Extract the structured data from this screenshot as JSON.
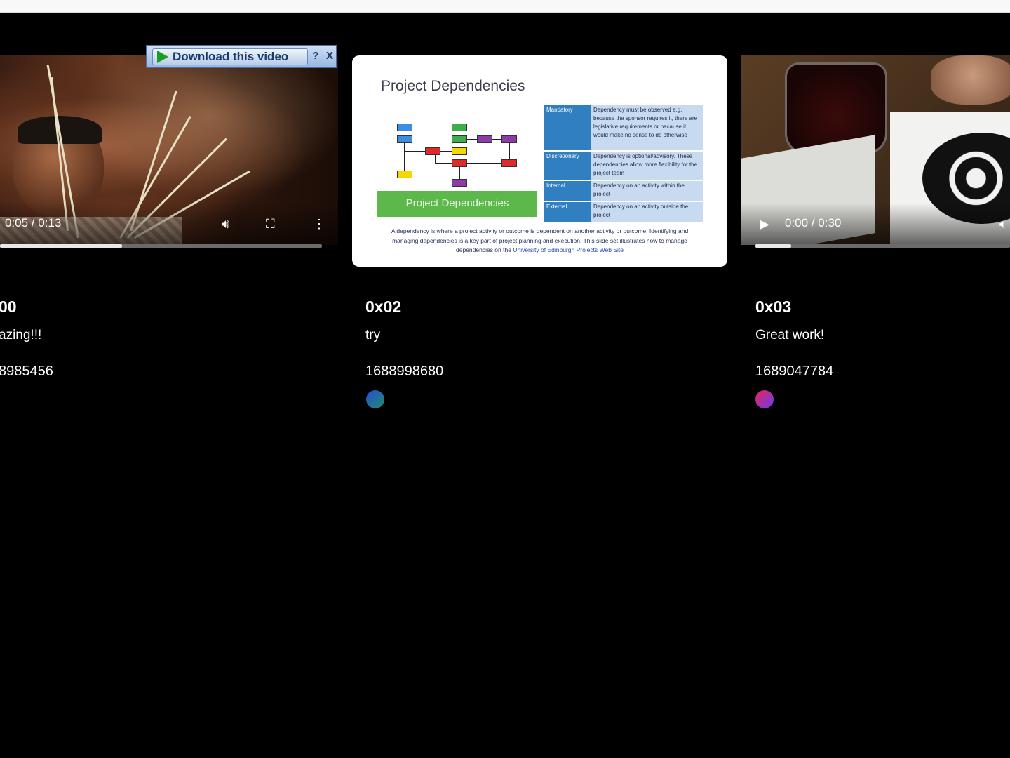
{
  "cards": [
    {
      "title": "00",
      "comment": "azing!!!",
      "timestamp": "8985456",
      "video": {
        "time_label": "0:05 / 0:13",
        "progress": 0.38
      },
      "download_bar": {
        "label": "Download this video",
        "help": "?",
        "close": "X"
      }
    },
    {
      "title": "0x02",
      "comment": "try",
      "timestamp": "1688998680",
      "avatar_colors": [
        "#2c4bd6",
        "#1b8f6a"
      ],
      "slide": {
        "title": "Project Dependencies",
        "banner": "Project Dependencies",
        "table": [
          {
            "key": "Mandatory",
            "value": "Dependency must be observed e.g. because the sponsor requires it, there are legislative requirements or because it would make no sense to do otherwise"
          },
          {
            "key": "Discretionary",
            "value": "Dependency is optional/advisory. These dependencies allow more flexibility for the project team"
          },
          {
            "key": "Internal",
            "value": "Dependency on an activity within the project"
          },
          {
            "key": "External",
            "value": "Dependency on an activity outside the project"
          }
        ],
        "caption": "A dependency is where a project activity or outcome is dependent on another activity or outcome. Identifying and managing dependencies is a key part of project planning and execution. This slide set illustrates how to manage dependencies on the",
        "caption_link": "University of Edinburgh Projects Web Site"
      }
    },
    {
      "title": "0x03",
      "comment": "Great work!",
      "timestamp": "1689047784",
      "avatar_colors": [
        "#e8235a",
        "#6a3cf0"
      ],
      "video": {
        "time_label": "0:00 / 0:30",
        "progress": 0.14
      }
    }
  ]
}
